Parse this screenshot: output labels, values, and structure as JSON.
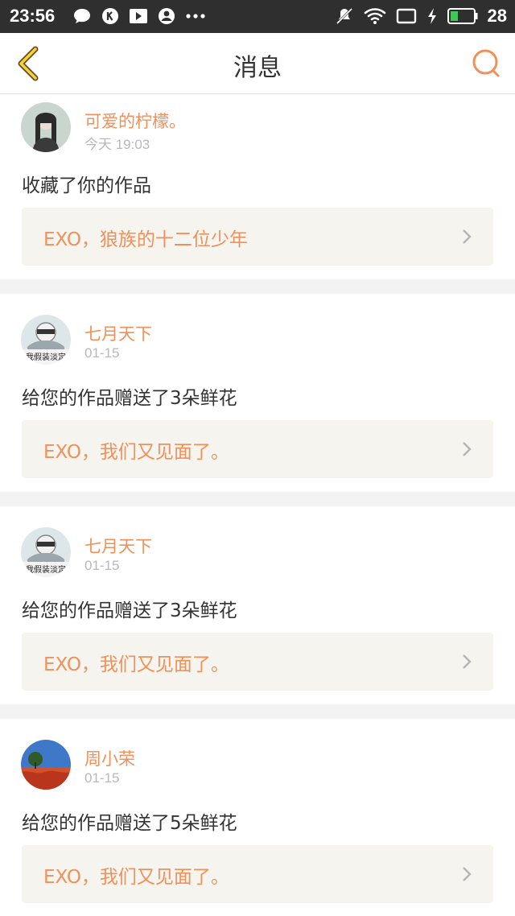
{
  "status_bar": {
    "time": "23:56",
    "battery_percent": "28",
    "left_icons": [
      "chat-bubble-icon",
      "k-app-icon",
      "video-play-icon",
      "user-circle-icon",
      "more-dots-icon"
    ],
    "right_icons": [
      "mute-icon",
      "wifi-icon",
      "screen-icon",
      "charging-icon",
      "battery-icon"
    ]
  },
  "header": {
    "title": "消息",
    "back_icon": "chevron-left-icon",
    "search_icon": "search-icon",
    "accent_color": "#f0905a"
  },
  "messages": [
    {
      "user": "可爱的柠檬。",
      "time": "今天 19:03",
      "action": "收藏了你的作品",
      "work_title": "EXO，狼族的十二位少年"
    },
    {
      "user": "七月天下",
      "time": "01-15",
      "action": "给您的作品赠送了3朵鲜花",
      "work_title": "EXO，我们又见面了。",
      "avatar_text": "我假装淡定"
    },
    {
      "user": "七月天下",
      "time": "01-15",
      "action": "给您的作品赠送了3朵鲜花",
      "work_title": "EXO，我们又见面了。",
      "avatar_text": "我假装淡定"
    },
    {
      "user": "周小荣",
      "time": "01-15",
      "action": "给您的作品赠送了5朵鲜花",
      "work_title": "EXO，我们又见面了。"
    }
  ]
}
